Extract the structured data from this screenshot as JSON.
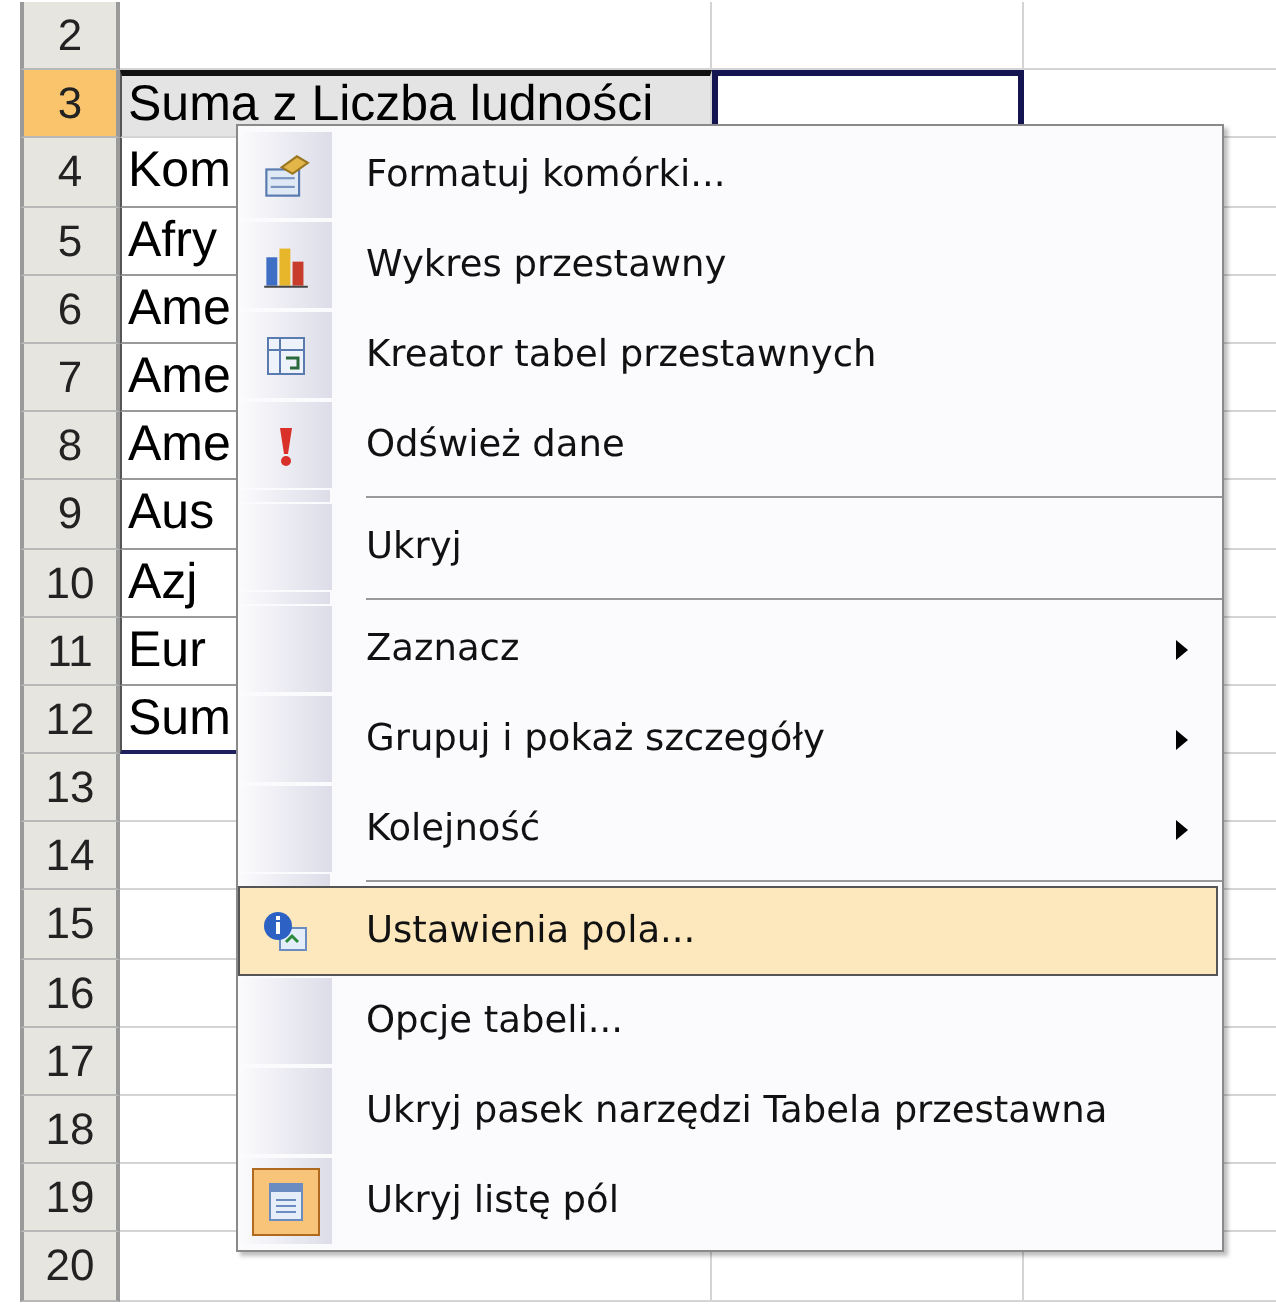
{
  "sheet": {
    "rows": [
      {
        "header": "2",
        "selected": false,
        "kind": "empty",
        "column_2_selected": false
      },
      {
        "header": "3",
        "selected": true,
        "kind": "pivot-title",
        "column_1": "Suma z Liczba ludności",
        "column_2_selected": true
      },
      {
        "header": "4",
        "selected": false,
        "kind": "pivot",
        "column_1": "Kom"
      },
      {
        "header": "5",
        "selected": false,
        "kind": "pivot",
        "column_1": "Afry"
      },
      {
        "header": "6",
        "selected": false,
        "kind": "pivot",
        "column_1": "Ame"
      },
      {
        "header": "7",
        "selected": false,
        "kind": "pivot",
        "column_1": "Ame"
      },
      {
        "header": "8",
        "selected": false,
        "kind": "pivot",
        "column_1": "Ame"
      },
      {
        "header": "9",
        "selected": false,
        "kind": "pivot",
        "column_1": "Aus"
      },
      {
        "header": "10",
        "selected": false,
        "kind": "pivot",
        "column_1": "Azj"
      },
      {
        "header": "11",
        "selected": false,
        "kind": "pivot",
        "column_1": "Eur"
      },
      {
        "header": "12",
        "selected": false,
        "kind": "pivot-total",
        "column_1": "Sum"
      },
      {
        "header": "13",
        "selected": false,
        "kind": "empty"
      },
      {
        "header": "14",
        "selected": false,
        "kind": "empty"
      },
      {
        "header": "15",
        "selected": false,
        "kind": "empty"
      },
      {
        "header": "16",
        "selected": false,
        "kind": "empty"
      },
      {
        "header": "17",
        "selected": false,
        "kind": "empty"
      },
      {
        "header": "18",
        "selected": false,
        "kind": "empty"
      },
      {
        "header": "19",
        "selected": false,
        "kind": "empty"
      },
      {
        "header": "20",
        "selected": false,
        "kind": "empty"
      }
    ]
  },
  "context_menu": {
    "items": [
      {
        "kind": "item",
        "label": "Formatuj komórki...",
        "submenu": false,
        "highlighted": false,
        "checked": false
      },
      {
        "kind": "item",
        "label": "Wykres przestawny",
        "submenu": false,
        "highlighted": false,
        "checked": false
      },
      {
        "kind": "item",
        "label": "Kreator tabel przestawnych",
        "submenu": false,
        "highlighted": false,
        "checked": false
      },
      {
        "kind": "item",
        "label": "Odśwież dane",
        "submenu": false,
        "highlighted": false,
        "checked": false
      },
      {
        "kind": "separator"
      },
      {
        "kind": "item",
        "label": "Ukryj",
        "submenu": false,
        "highlighted": false,
        "checked": false
      },
      {
        "kind": "separator"
      },
      {
        "kind": "item",
        "label": "Zaznacz",
        "submenu": true,
        "highlighted": false,
        "checked": false
      },
      {
        "kind": "item",
        "label": "Grupuj i pokaż szczegóły",
        "submenu": true,
        "highlighted": false,
        "checked": false
      },
      {
        "kind": "item",
        "label": "Kolejność",
        "submenu": true,
        "highlighted": false,
        "checked": false
      },
      {
        "kind": "separator"
      },
      {
        "kind": "item",
        "label": "Ustawienia pola...",
        "submenu": false,
        "highlighted": true,
        "checked": false
      },
      {
        "kind": "item",
        "label": "Opcje tabeli...",
        "submenu": false,
        "highlighted": false,
        "checked": false
      },
      {
        "kind": "item",
        "label": "Ukryj pasek narzędzi Tabela przestawna",
        "submenu": false,
        "highlighted": false,
        "checked": false
      },
      {
        "kind": "item",
        "label": "Ukryj listę pól",
        "submenu": false,
        "highlighted": false,
        "checked": true
      }
    ]
  }
}
